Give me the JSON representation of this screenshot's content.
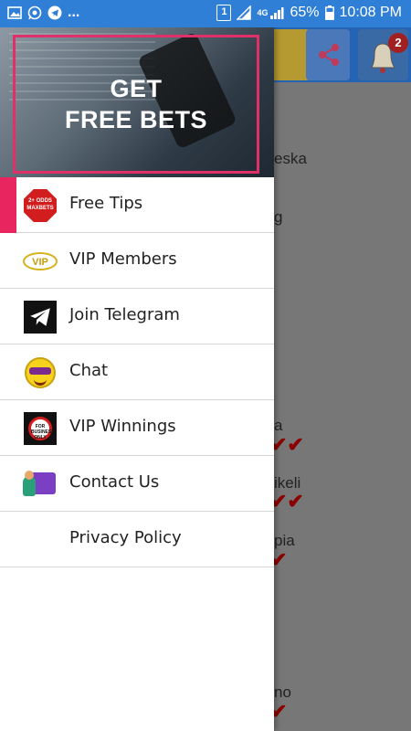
{
  "status_bar": {
    "battery": "65%",
    "time": "10:08 PM",
    "network": "4G",
    "sim_slot": "1",
    "icons": [
      "image-icon",
      "whatsapp-icon",
      "telegram-icon"
    ],
    "more": "..."
  },
  "background_app": {
    "notification_count": "2",
    "visible_fragments": [
      "eska",
      "g",
      "a",
      "ikeli",
      "pia",
      "no"
    ]
  },
  "drawer": {
    "header_title_line1": "GET",
    "header_title_line2": "FREE BETS",
    "accent_color": "#e8255e",
    "items": [
      {
        "label": "Free Tips",
        "icon": "stop-sign-icon",
        "icon_text": "2+ ODDS MAXBETS",
        "active": true
      },
      {
        "label": "VIP Members",
        "icon": "vip-icon",
        "icon_text": "VIP"
      },
      {
        "label": "Join Telegram",
        "icon": "telegram-icon"
      },
      {
        "label": "Chat",
        "icon": "sunglasses-emoji-icon"
      },
      {
        "label": "VIP Winnings",
        "icon": "business-sign-icon",
        "icon_text": "FOR BUSINESS ONLY"
      },
      {
        "label": "Contact Us",
        "icon": "contact-card-icon"
      },
      {
        "label": "Privacy Policy",
        "icon": ""
      }
    ]
  }
}
